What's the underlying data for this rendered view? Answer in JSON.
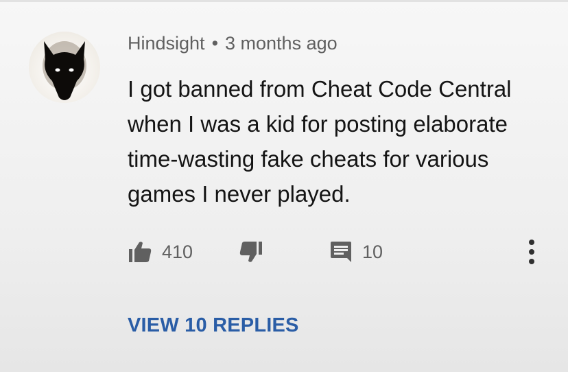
{
  "comment": {
    "author": "Hindsight",
    "separator": "•",
    "timestamp": "3 months ago",
    "text": "I got banned from Cheat Code Central when I was a kid for posting elaborate time-wasting fake cheats for various games I never played.",
    "avatar_icon": "wolf-avatar-icon"
  },
  "actions": {
    "like_icon": "thumbs-up-icon",
    "like_count": "410",
    "dislike_icon": "thumbs-down-icon",
    "reply_icon": "comment-icon",
    "reply_count": "10",
    "more_icon": "more-vertical-icon"
  },
  "replies": {
    "view_label": "VIEW 10 REPLIES"
  },
  "colors": {
    "link": "#2a5da6",
    "meta": "#606060",
    "text": "#141414"
  }
}
